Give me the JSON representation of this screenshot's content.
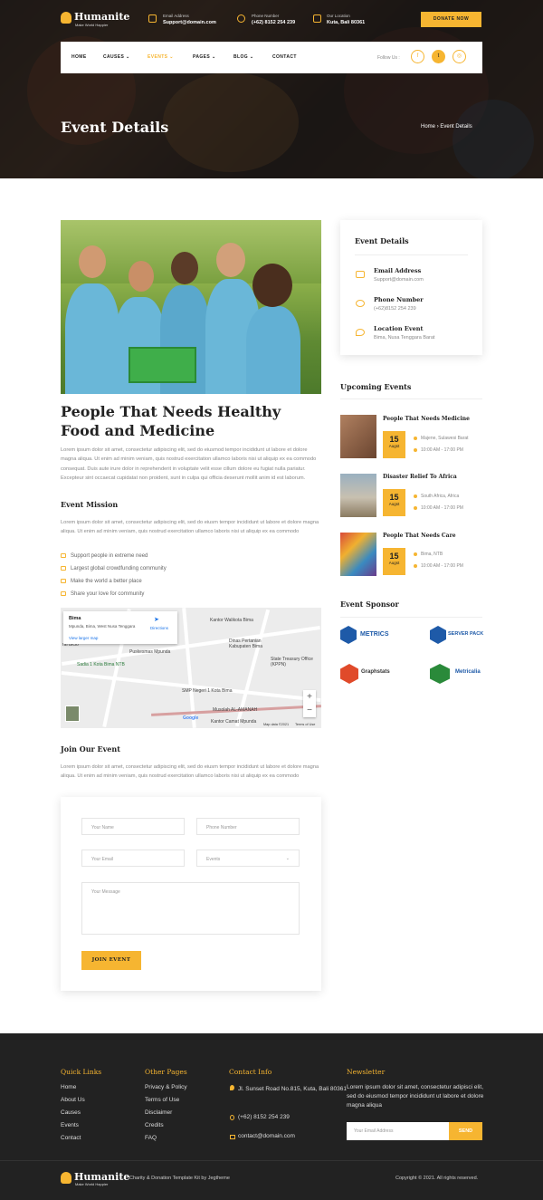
{
  "brand": {
    "name": "Humanite",
    "tagline": "Make World Happier"
  },
  "contact": {
    "email_label": "Email Address",
    "email": "Support@domain.com",
    "phone_label": "Phone Number",
    "phone": "(+62) 8152 254 239",
    "location_label": "Our Location",
    "location": "Kuta, Bali 80361"
  },
  "donate_label": "DONATE NOW",
  "nav": {
    "items": [
      "HOME",
      "CAUSES",
      "EVENTS",
      "PAGES",
      "BLOG",
      "CONTACT"
    ],
    "follow_label": "Follow Us :",
    "social": [
      "facebook-icon",
      "twitter-icon",
      "instagram-icon"
    ]
  },
  "hero": {
    "title": "Event Details",
    "breadcrumb_home": "Home",
    "breadcrumb_current": "Event Details"
  },
  "main": {
    "title": "People That Needs Healthy Food and Medicine",
    "intro": "Lorem ipsum dolor sit amet, consectetur adipiscing elit, sed do eiusmod tempor incididunt ut labore et dolore magna aliqua. Ut enim ad minim veniam, quis nostrud exercitation ullamco laboris nisi ut aliquip ex ea commodo consequat. Duis aute irure dolor in reprehenderit in voluptate velit esse cillum dolore eu fugiat nulla pariatur. Excepteur sint occaecat cupidatat non proident, sunt in culpa qui officia deserunt mollit anim id est laborum.",
    "mission_title": "Event Mission",
    "mission_text": "Lorem ipsum dolor sit amet, consectetur adipiscing elit, sed do eiusm tempor incididunt ut labore et dolore magna aliqua. Ut enim ad minim veniam, quis nostrud exercitation ullamco laboris nisi ut aliquip ex ea commodo",
    "mission_items": [
      "Support people in extreme need",
      "Largest global crowdfunding community",
      "Make the world a better place",
      "Share your love for community"
    ],
    "join_title": "Join Our Event",
    "join_text": "Lorem ipsum dolor sit amet, consectetur adipiscing elit, sed do eiusm tempor incididunt ut labore et dolore magna aliqua. Ut enim ad minim veniam, quis nostrud exercitation ullamco laboris nisi ut aliquip ex ea commodo"
  },
  "map": {
    "place": "Bima",
    "address": "Mpunda, Bima, West Nusa Tenggara",
    "directions": "Directions",
    "larger": "View larger map",
    "labels": [
      "Kantor Walikota Bima",
      "Dinas Pertanian Kabupaten Bima",
      "Puskesmas Mpunda",
      "State Treasury Office (KPPN)",
      "Sadia 1 Kota Bima NTB",
      "SMP Negeri 1 Kota Bima",
      "Musolah AL-AMANAH",
      "Kantor Camat Mpunda",
      "ral Bicio"
    ],
    "attribution": "Map data ©2021",
    "terms": "Terms of Use",
    "google": "Google"
  },
  "form": {
    "name_ph": "Your Name",
    "phone_ph": "Phone Number",
    "email_ph": "Your Email",
    "events_ph": "Events",
    "message_ph": "Your Message",
    "submit": "JOIN EVENT"
  },
  "sidebar": {
    "details_title": "Event Details",
    "email_label": "Email Address",
    "email": "Support@domain.com",
    "phone_label": "Phone Number",
    "phone": "(+62)8152 254 239",
    "location_label": "Location Event",
    "location": "Bima, Nusa Tenggara Barat",
    "upcoming_title": "Upcoming Events",
    "events": [
      {
        "title": "People That Needs Medicine",
        "day": "15",
        "month": "Augst",
        "place": "Majene, Sulawesi Barat",
        "time": "10:00 AM - 17:00 PM"
      },
      {
        "title": "Disaster Relief To Africa",
        "day": "15",
        "month": "Augst",
        "place": "South Africa, Africa",
        "time": "10:00 AM - 17:00 PM"
      },
      {
        "title": "People That Needs Care",
        "day": "15",
        "month": "Augst",
        "place": "Bima, NTB",
        "time": "10:00 AM - 17:00 PM"
      }
    ],
    "sponsor_title": "Event Sponsor",
    "sponsors": [
      "METRICS",
      "SERVER PACK",
      "Graphstats",
      "Metricalia"
    ],
    "sponsor_colors": [
      "#1e5aa8",
      "#1e5aa8",
      "#e04a2a",
      "#2a8a3a"
    ]
  },
  "footer": {
    "quick_title": "Quick Links",
    "quick": [
      "Home",
      "About Us",
      "Causes",
      "Events",
      "Contact"
    ],
    "other_title": "Other Pages",
    "other": [
      "Privacy & Policy",
      "Terms of Use",
      "Disclaimer",
      "Credits",
      "FAQ"
    ],
    "contact_title": "Contact Info",
    "address": "Jl. Sunset Road No.815, Kuta, Bali 80361",
    "phone": "(+62) 8152 254 239",
    "email": "contact@domain.com",
    "news_title": "Newsletter",
    "news_text": "Lorem ipsum dolor sit amet, consectetur adipisci elit, sed do eiusmod tempor incididunt ut labore et dolore magna aliqua",
    "news_ph": "Your Email Address",
    "news_btn": "SEND",
    "credit": "Charity & Donation Template Kit by Jegtheme",
    "copyright": "Copyright © 2021. All rights reserved."
  },
  "colors": {
    "accent": "#f6b531",
    "dark": "#222222"
  }
}
